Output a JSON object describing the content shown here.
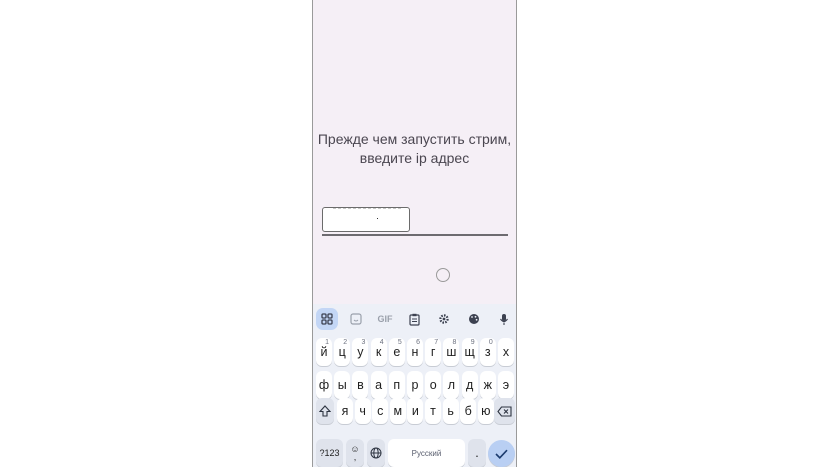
{
  "screen": {
    "prompt_line1": "Прежде чем запустить стрим,",
    "prompt_line2": "введите ip адрес",
    "ip_value": ""
  },
  "keyboard": {
    "toolbar": [
      "apps-grid-icon",
      "sticker-icon",
      "gif-label",
      "clipboard-icon",
      "settings-icon",
      "palette-icon",
      "mic-icon"
    ],
    "gif_label": "GIF",
    "row1": [
      "й",
      "ц",
      "у",
      "к",
      "е",
      "н",
      "г",
      "ш",
      "щ",
      "з",
      "х"
    ],
    "row1_numbers": [
      "1",
      "2",
      "3",
      "4",
      "5",
      "6",
      "7",
      "8",
      "9",
      "0",
      ""
    ],
    "row2": [
      "ф",
      "ы",
      "в",
      "а",
      "п",
      "р",
      "о",
      "л",
      "д",
      "ж",
      "э"
    ],
    "row3": [
      "я",
      "ч",
      "с",
      "м",
      "и",
      "т",
      "ь",
      "б",
      "ю"
    ],
    "symbols_label": "?123",
    "comma_label": ",",
    "space_label": "Русский",
    "period_label": ".",
    "accent_color": "#b9cff3"
  }
}
